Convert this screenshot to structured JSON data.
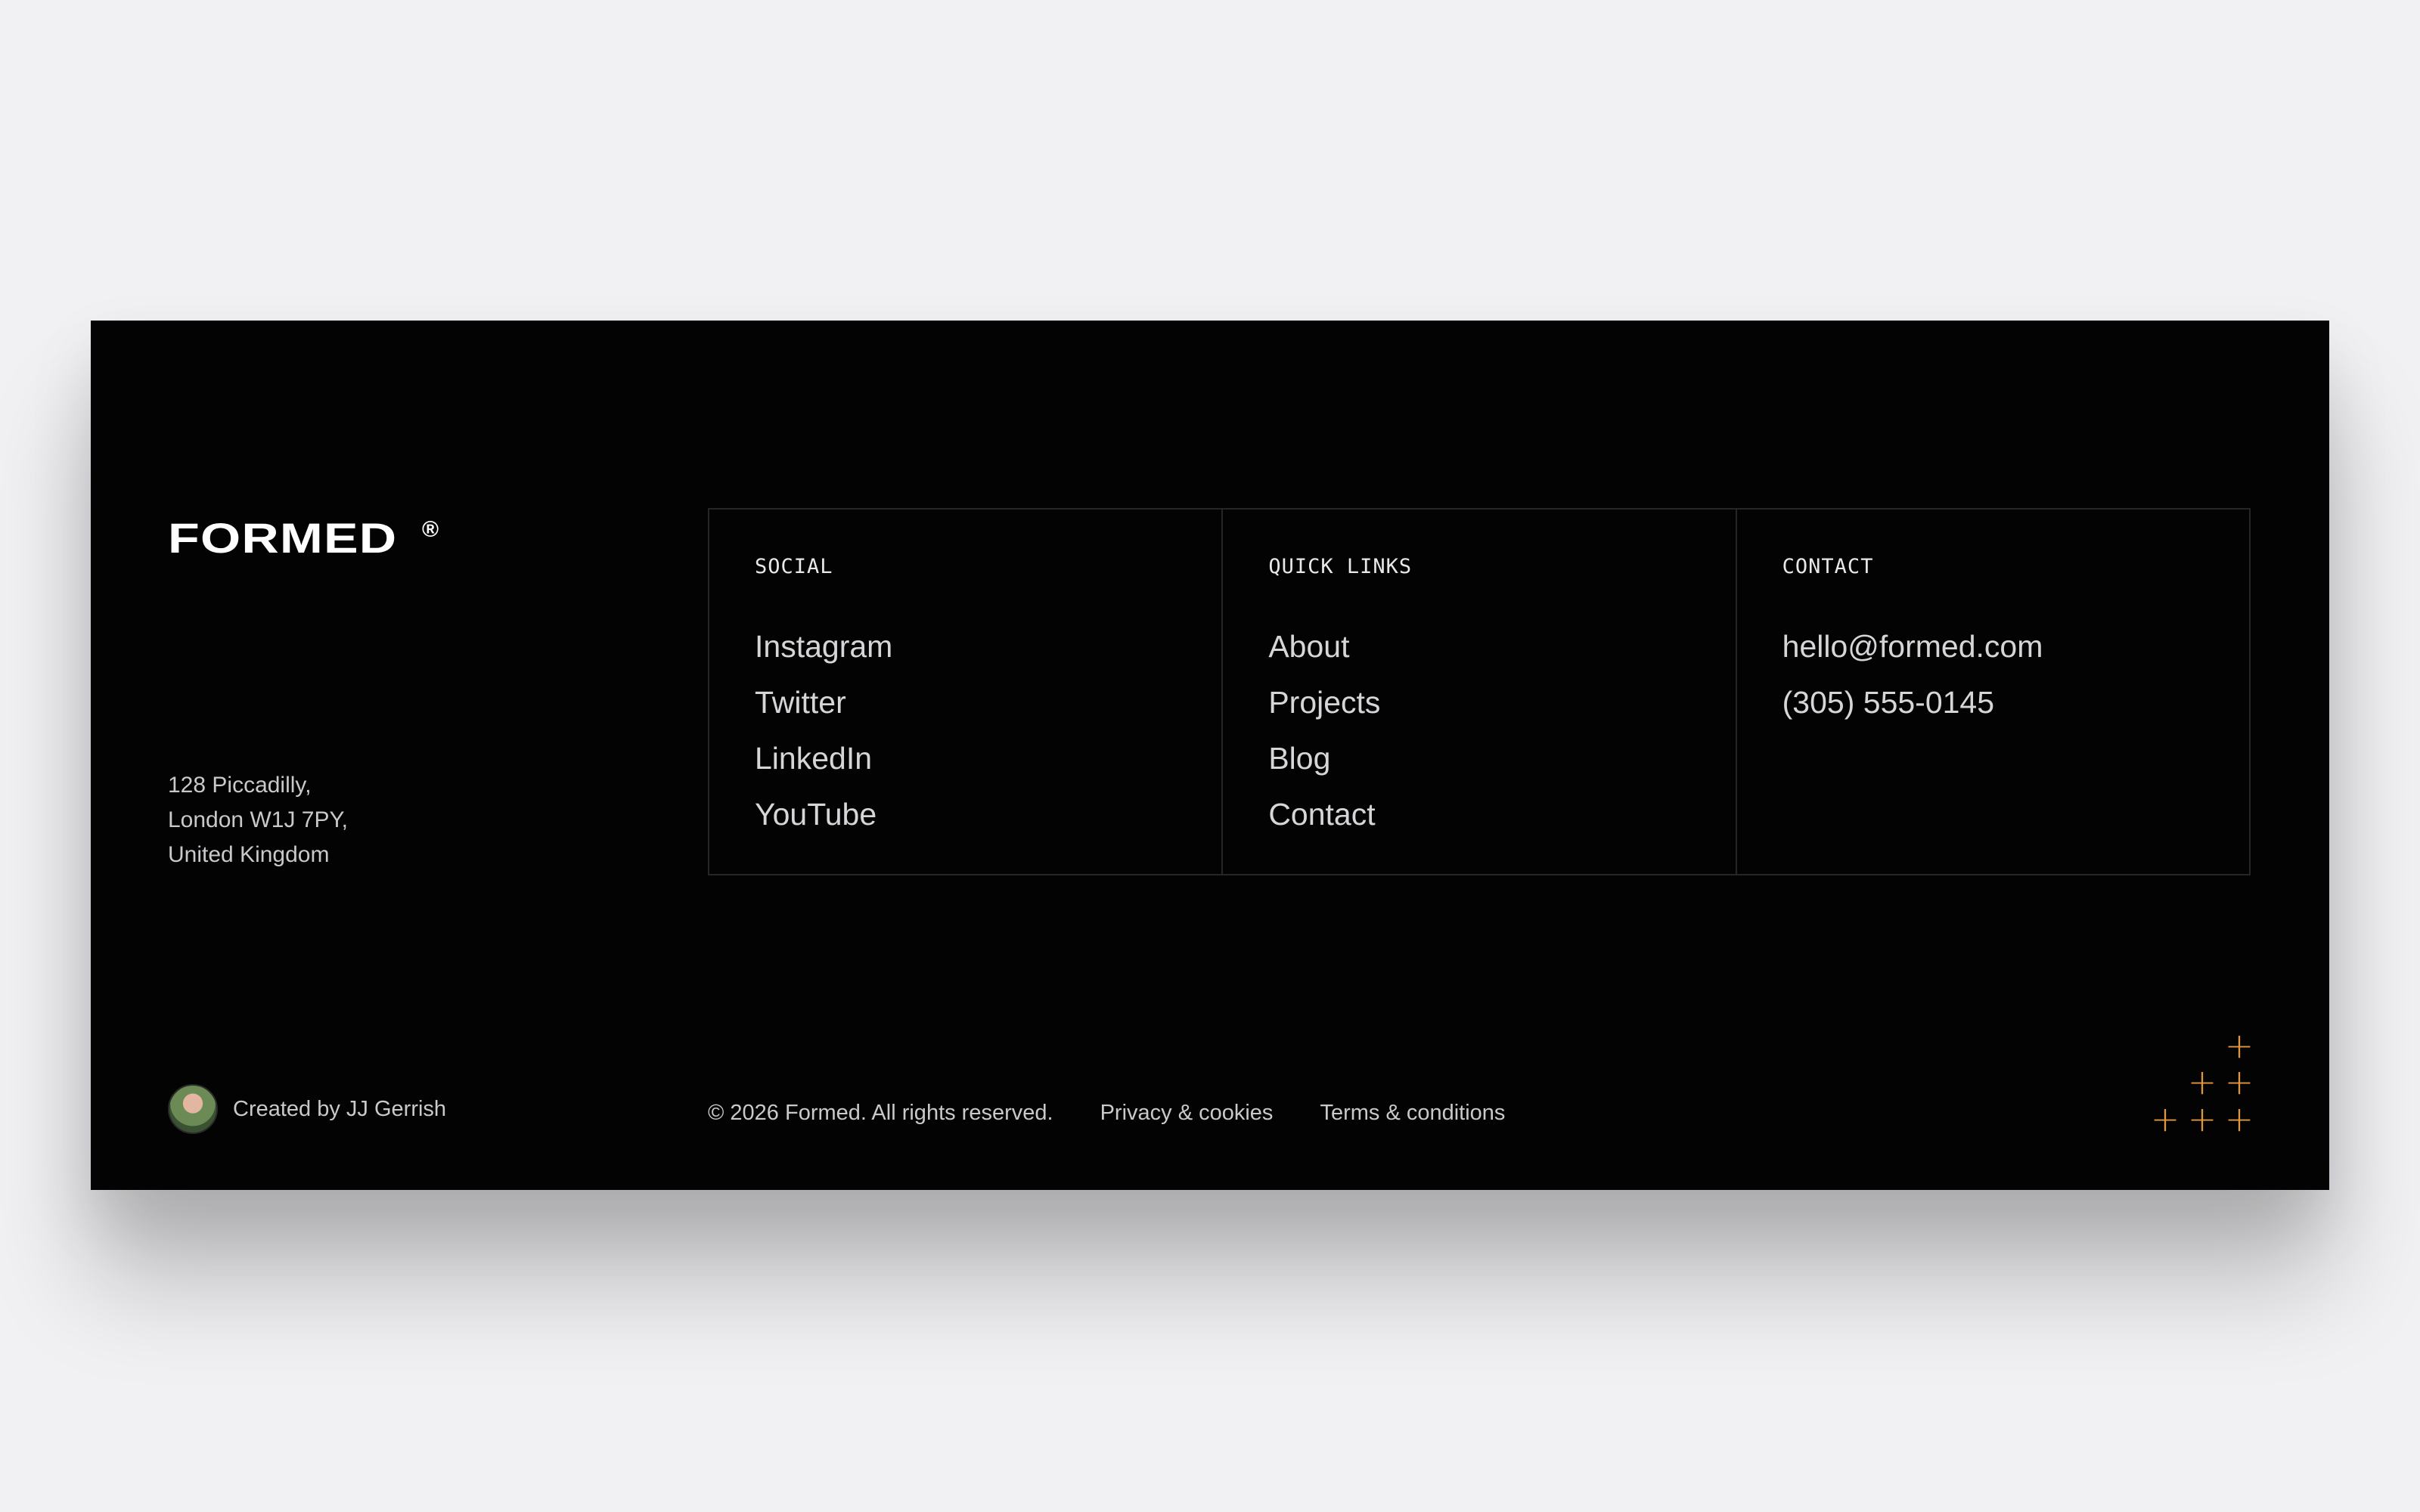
{
  "brand": {
    "logo_text": "FORMED",
    "logo_mark": "®"
  },
  "address": {
    "lines": [
      "128 Piccadilly,",
      "London W1J 7PY,",
      "United Kingdom"
    ]
  },
  "columns": [
    {
      "title": "SOCIAL",
      "links": [
        "Instagram",
        "Twitter",
        "LinkedIn",
        "YouTube"
      ]
    },
    {
      "title": "QUICK LINKS",
      "links": [
        "About",
        "Projects",
        "Blog",
        "Contact"
      ]
    },
    {
      "title": "CONTACT",
      "links": [
        "hello@formed.com",
        "(305) 555-0145"
      ]
    }
  ],
  "creator": {
    "text": "Created by JJ Gerrish",
    "avatar_icon": "avatar"
  },
  "footer_bar": {
    "copyright": "© 2026 Formed. All rights reserved.",
    "privacy": "Privacy & cookies",
    "terms": "Terms & conditions"
  },
  "decor": {
    "icon": "plus-icon",
    "color": "#e2963f",
    "glyph": "+"
  },
  "colors": {
    "page_bg": "#f1f0f3",
    "card_bg": "#030304",
    "accent": "#e2963f"
  }
}
